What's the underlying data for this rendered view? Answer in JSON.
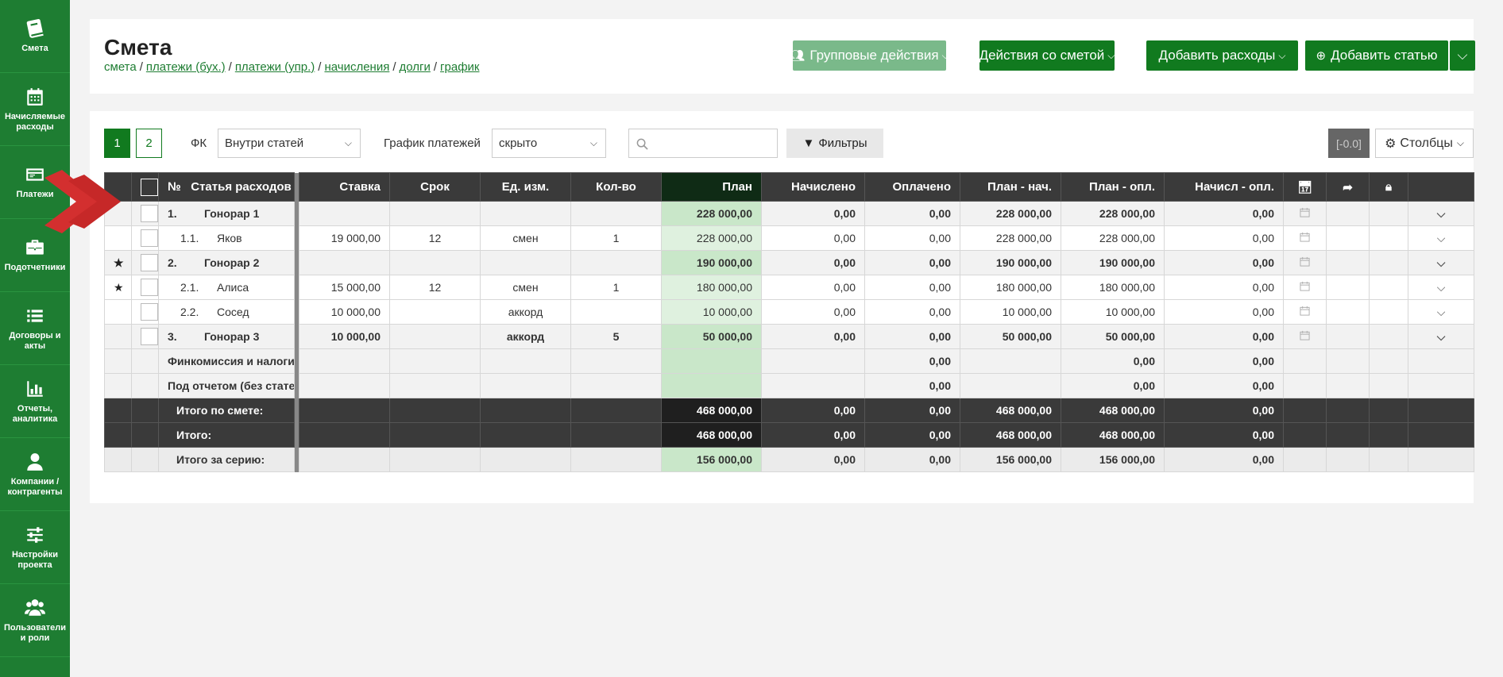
{
  "sidebar": {
    "items": [
      {
        "label": "Смета",
        "icon": "book-icon"
      },
      {
        "label": "Начисляемые расходы",
        "icon": "calendar-icon"
      },
      {
        "label": "Платежи",
        "icon": "payment-icon"
      },
      {
        "label": "Подотчетники",
        "icon": "briefcase-icon"
      },
      {
        "label": "Договоры и акты",
        "icon": "list-icon"
      },
      {
        "label": "Отчеты, аналитика",
        "icon": "bar-chart-icon"
      },
      {
        "label": "Компании / контрагенты",
        "icon": "user-icon"
      },
      {
        "label": "Настройки проекта",
        "icon": "sliders-icon"
      },
      {
        "label": "Пользователи и роли",
        "icon": "users-icon"
      }
    ]
  },
  "header": {
    "title": "Смета",
    "breadcrumbs": [
      {
        "label": "смета",
        "link": false
      },
      {
        "label": "платежи (бух.)",
        "link": true
      },
      {
        "label": "платежи (упр.)",
        "link": true
      },
      {
        "label": "начисления",
        "link": true
      },
      {
        "label": "долги",
        "link": true
      },
      {
        "label": "график",
        "link": true
      }
    ],
    "buttons": {
      "group_actions": "Групповые действия",
      "estimate_actions": "Действия со сметой",
      "add_expenses": "Добавить расходы",
      "add_article": "Добавить статью"
    }
  },
  "toolbar": {
    "pages": [
      "1",
      "2"
    ],
    "fk_label": "ФК",
    "fk_value": "Внутри статей",
    "schedule_label": "График платежей",
    "schedule_value": "скрыто",
    "search_placeholder": "",
    "filters_label": "Фильтры",
    "zoom_value": "[-0.0]",
    "columns_label": "Столбцы"
  },
  "table": {
    "headers": {
      "num": "№",
      "article": "Статья расходов",
      "rate": "Ставка",
      "term": "Срок",
      "unit": "Ед. изм.",
      "qty": "Кол-во",
      "plan": "План",
      "accrued": "Начислено",
      "paid": "Оплачено",
      "plan_accr": "План - нач.",
      "plan_paid": "План - опл.",
      "accr_paid": "Начисл - опл."
    },
    "rows": [
      {
        "level": 0,
        "star": false,
        "code": "1.",
        "name": "Гонорар 1",
        "rate": "",
        "term": "",
        "unit": "",
        "qty": "",
        "plan": "228 000,00",
        "accrued": "0,00",
        "paid": "0,00",
        "plan_accr": "228 000,00",
        "plan_paid": "228 000,00",
        "accr_paid": "0,00"
      },
      {
        "level": 1,
        "star": false,
        "code": "1.1.",
        "name": "Яков",
        "rate": "19 000,00",
        "term": "12",
        "unit": "смен",
        "qty": "1",
        "plan": "228 000,00",
        "accrued": "0,00",
        "paid": "0,00",
        "plan_accr": "228 000,00",
        "plan_paid": "228 000,00",
        "accr_paid": "0,00"
      },
      {
        "level": 0,
        "star": true,
        "code": "2.",
        "name": "Гонорар 2",
        "rate": "",
        "term": "",
        "unit": "",
        "qty": "",
        "plan": "190 000,00",
        "accrued": "0,00",
        "paid": "0,00",
        "plan_accr": "190 000,00",
        "plan_paid": "190 000,00",
        "accr_paid": "0,00"
      },
      {
        "level": 1,
        "star": true,
        "code": "2.1.",
        "name": "Алиса",
        "rate": "15 000,00",
        "term": "12",
        "unit": "смен",
        "qty": "1",
        "plan": "180 000,00",
        "accrued": "0,00",
        "paid": "0,00",
        "plan_accr": "180 000,00",
        "plan_paid": "180 000,00",
        "accr_paid": "0,00"
      },
      {
        "level": 1,
        "star": false,
        "code": "2.2.",
        "name": "Сосед",
        "rate": "10 000,00",
        "term": "",
        "unit": "аккорд",
        "qty": "",
        "plan": "10 000,00",
        "accrued": "0,00",
        "paid": "0,00",
        "plan_accr": "10 000,00",
        "plan_paid": "10 000,00",
        "accr_paid": "0,00"
      },
      {
        "level": 0,
        "star": false,
        "code": "3.",
        "name": "Гонорар 3",
        "rate": "10 000,00",
        "term": "",
        "unit": "аккорд",
        "qty": "5",
        "plan": "50 000,00",
        "accrued": "0,00",
        "paid": "0,00",
        "plan_accr": "50 000,00",
        "plan_paid": "50 000,00",
        "accr_paid": "0,00"
      }
    ],
    "extra_rows": [
      {
        "name": "Финкомиссия и налоги",
        "paid": "0,00",
        "plan_paid": "0,00",
        "accr_paid": "0,00"
      },
      {
        "name": "Под отчетом (без статей)",
        "paid": "0,00",
        "plan_paid": "0,00",
        "accr_paid": "0,00"
      }
    ],
    "totals": [
      {
        "kind": "total",
        "name": "Итого по смете:",
        "plan": "468 000,00",
        "accrued": "0,00",
        "paid": "0,00",
        "plan_accr": "468 000,00",
        "plan_paid": "468 000,00",
        "accr_paid": "0,00"
      },
      {
        "kind": "total",
        "name": "Итого:",
        "plan": "468 000,00",
        "accrued": "0,00",
        "paid": "0,00",
        "plan_accr": "468 000,00",
        "plan_paid": "468 000,00",
        "accr_paid": "0,00"
      },
      {
        "kind": "series",
        "name": "Итого за серию:",
        "plan": "156 000,00",
        "accrued": "0,00",
        "paid": "0,00",
        "plan_accr": "156 000,00",
        "plan_paid": "156 000,00",
        "accr_paid": "0,00"
      }
    ]
  },
  "colors": {
    "sidebar": "#1e7d32",
    "primary_button": "#117a1f",
    "group_button": "#7ab98a",
    "plan_column": "#d6edd6",
    "arrow": "#d32f2f"
  }
}
